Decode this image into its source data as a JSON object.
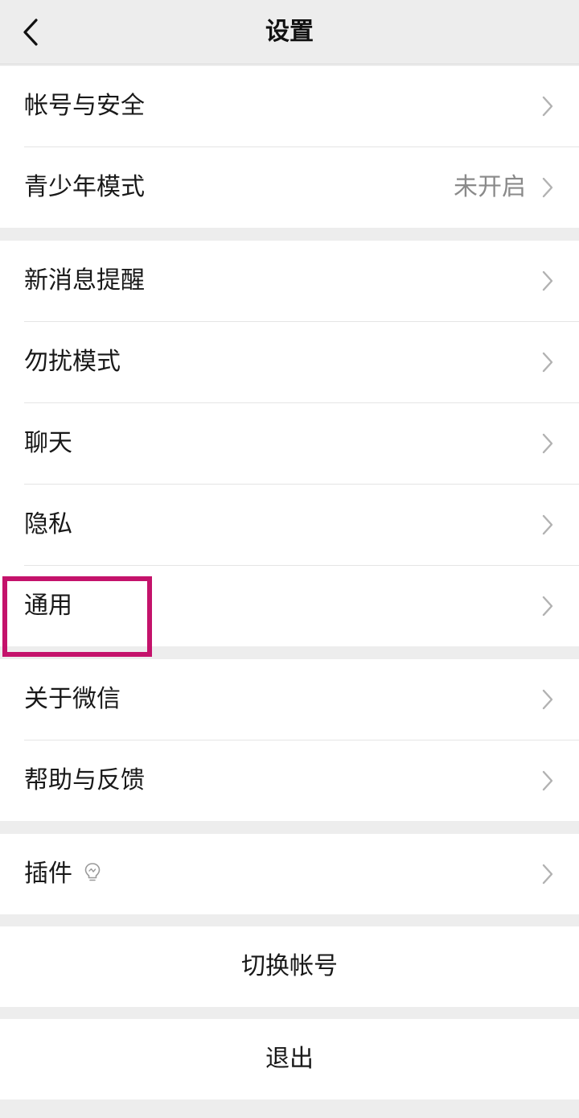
{
  "nav": {
    "title": "设置",
    "back_icon": "chevron-left-icon"
  },
  "groups": [
    {
      "items": [
        {
          "label": "帐号与安全",
          "value": ""
        },
        {
          "label": "青少年模式",
          "value": "未开启"
        }
      ]
    },
    {
      "items": [
        {
          "label": "新消息提醒",
          "value": ""
        },
        {
          "label": "勿扰模式",
          "value": ""
        },
        {
          "label": "聊天",
          "value": ""
        },
        {
          "label": "隐私",
          "value": ""
        },
        {
          "label": "通用",
          "value": ""
        }
      ]
    },
    {
      "items": [
        {
          "label": "关于微信",
          "value": ""
        },
        {
          "label": "帮助与反馈",
          "value": ""
        }
      ]
    },
    {
      "items": [
        {
          "label": "插件",
          "value": "",
          "icon": "lightbulb-icon"
        }
      ]
    }
  ],
  "actions": {
    "switch_account": "切换帐号",
    "logout": "退出"
  },
  "colors": {
    "background": "#ededed",
    "card": "#ffffff",
    "text": "#191919",
    "secondary_text": "#8a8a8a",
    "highlight": "#c4126b"
  }
}
